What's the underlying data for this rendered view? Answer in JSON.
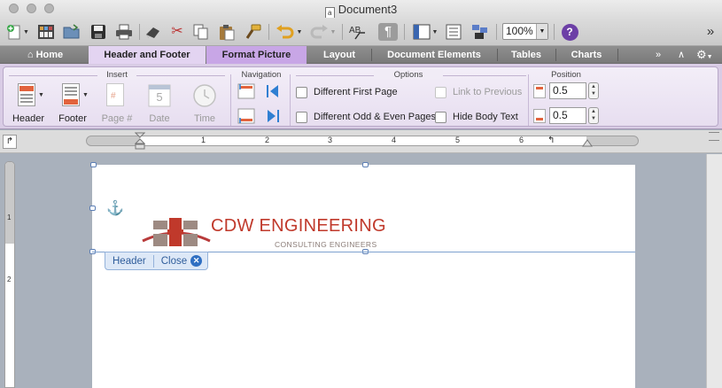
{
  "window": {
    "title": "Document3",
    "doc_icon_letter": "a"
  },
  "toolbar": {
    "new_icon": "new-document-icon",
    "zoom": "100%",
    "help_label": "?"
  },
  "tabs": [
    {
      "label": "Home",
      "icon": "home-icon"
    },
    {
      "label": "Header and Footer"
    },
    {
      "label": "Format Picture"
    },
    {
      "label": "Layout"
    },
    {
      "label": "Document Elements"
    },
    {
      "label": "Tables"
    },
    {
      "label": "Charts"
    }
  ],
  "ribbon": {
    "insert": {
      "title": "Insert",
      "header_label": "Header",
      "footer_label": "Footer",
      "page_label": "Page #",
      "date_label": "Date",
      "date_number": "5",
      "time_label": "Time"
    },
    "navigation": {
      "title": "Navigation"
    },
    "options": {
      "title": "Options",
      "different_first_page": "Different First Page",
      "different_odd_even": "Different Odd & Even Pages",
      "link_to_previous": "Link to Previous",
      "hide_body_text": "Hide Body Text"
    },
    "position": {
      "title": "Position",
      "top_value": "0.5",
      "bottom_value": "0.5"
    }
  },
  "ruler": {
    "numbers": [
      "1",
      "2",
      "3",
      "4",
      "5",
      "6"
    ]
  },
  "vruler": {
    "numbers": [
      "1",
      "2"
    ]
  },
  "document": {
    "logo_title": "CDW ENGINEERING",
    "logo_subtitle": "CONSULTING ENGINEERS",
    "header_tag": {
      "label": "Header",
      "close_label": "Close"
    }
  },
  "colors": {
    "ribbon_bg": "#e7def0",
    "accent_tab": "#c8a6e6",
    "logo_red": "#c0392b",
    "logo_grey": "#9d8a82",
    "help_purple": "#6c3fa6"
  }
}
